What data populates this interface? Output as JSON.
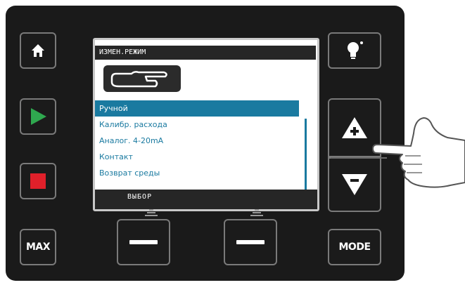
{
  "screen": {
    "title": "ИЗМЕН.РЕЖИМ",
    "menu_items": [
      {
        "label": "Ручной",
        "selected": true
      },
      {
        "label": "Калибр. расхода",
        "selected": false
      },
      {
        "label": "Аналог. 4-20mA",
        "selected": false
      },
      {
        "label": "Контакт",
        "selected": false
      },
      {
        "label": "Возврат среды",
        "selected": false
      }
    ],
    "footer_label": "ВЫБОР",
    "mode_icon": "hand-pointer-icon"
  },
  "buttons": {
    "max_label": "MAX",
    "mode_label": "MODE",
    "home_icon": "home-icon",
    "start_icon": "play-icon",
    "stop_icon": "stop-icon",
    "light_icon": "lightbulb-icon",
    "up_icon": "up-plus-icon",
    "down_icon": "down-minus-icon"
  },
  "colors": {
    "device_body": "#1a1a1a",
    "accent_blue": "#1a7aa0",
    "start_green": "#2fa84f",
    "stop_red": "#e0202a"
  }
}
